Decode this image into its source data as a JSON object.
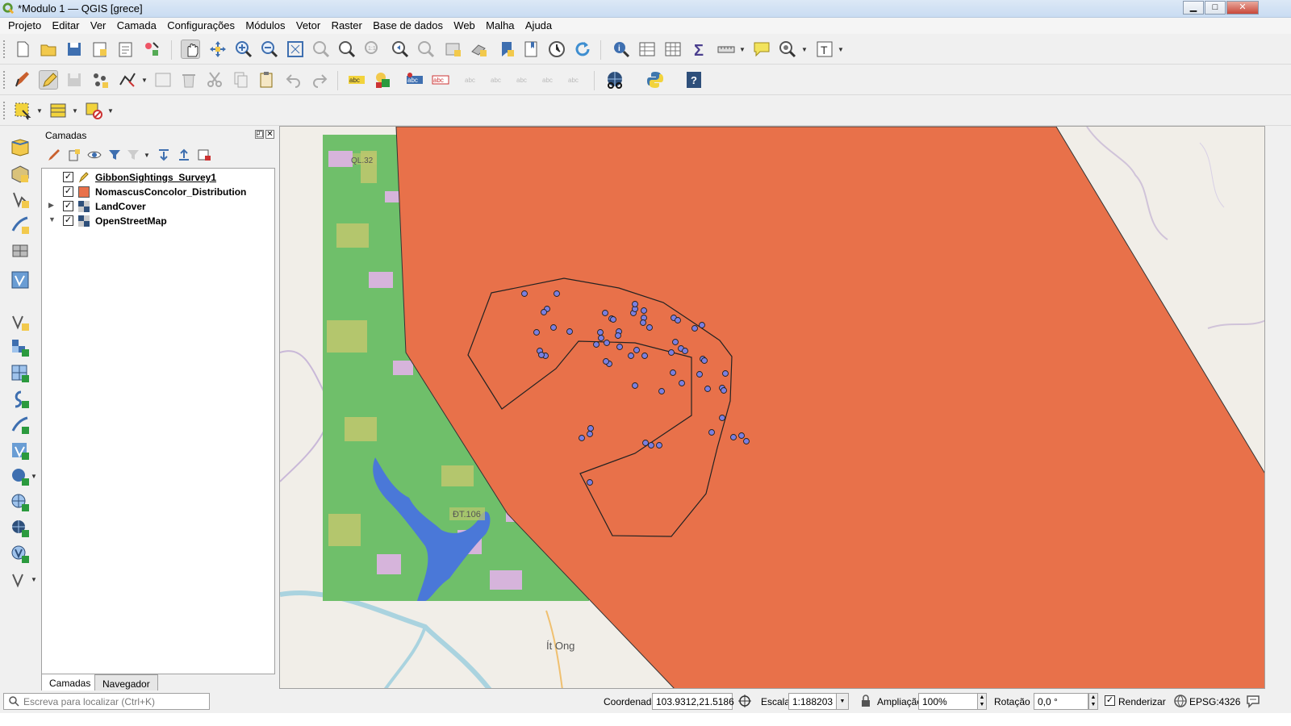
{
  "window": {
    "title": "*Modulo 1 — QGIS [grece]",
    "controls": {
      "minimize": "▁",
      "maximize": "□",
      "close": "✕"
    }
  },
  "menu": [
    "Projeto",
    "Editar",
    "Ver",
    "Camada",
    "Configurações",
    "Módulos",
    "Vetor",
    "Raster",
    "Base de dados",
    "Web",
    "Malha",
    "Ajuda"
  ],
  "layers_panel": {
    "title": "Camadas",
    "title_buttons": [
      "◰",
      "✕"
    ],
    "layers": [
      {
        "name": "GibbonSightings_Survey1",
        "checked": "✓",
        "expand": "",
        "symbol": "pencil-icon",
        "editing": true
      },
      {
        "name": "NomascusConcolor_Distribution",
        "checked": "✓",
        "expand": "",
        "symbol": "polygon-fill",
        "color": "#e8714a"
      },
      {
        "name": "LandCover",
        "checked": "✓",
        "expand": "▶",
        "symbol": "raster-icon"
      },
      {
        "name": "OpenStreetMap",
        "checked": "✓",
        "expand": "▼",
        "symbol": "raster-icon"
      }
    ]
  },
  "panel_tabs": [
    "Camadas",
    "Navegador"
  ],
  "map": {
    "labels": [
      "QL.32",
      "ĐT.106",
      "Ít Ong"
    ],
    "colors": {
      "distribution_fill": "#e8714a",
      "landcover_green": "#6fbf6a",
      "water": "#4a78d8",
      "point_fill": "#7b7fe0",
      "background": "#f1eee8"
    }
  },
  "statusbar": {
    "locator_placeholder": "Escreva para localizar (Ctrl+K)",
    "coordinate_label": "Coordenada",
    "coordinate_value": "103.9312,21.5186",
    "scale_label": "Escala",
    "scale_value": "1:188203",
    "magnifier_label": "Ampliação",
    "magnifier_value": "100%",
    "rotation_label": "Rotação",
    "rotation_value": "0,0 °",
    "render_label": "Renderizar",
    "render_checked": "✓",
    "crs": "EPSG:4326"
  }
}
